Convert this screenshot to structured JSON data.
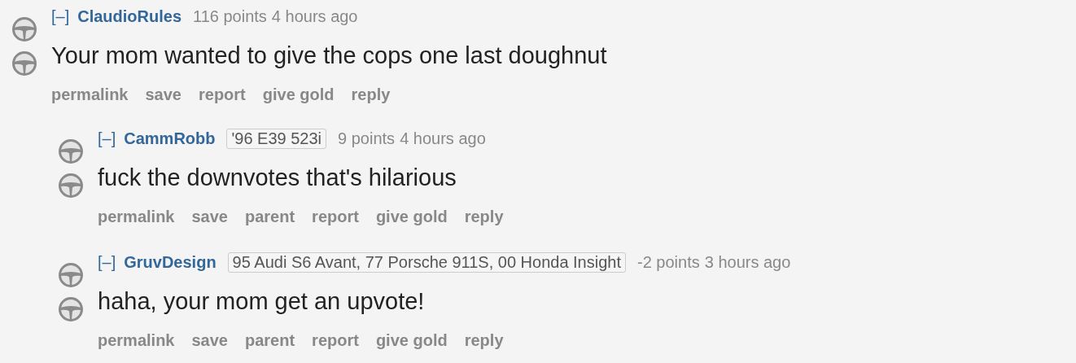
{
  "comments": [
    {
      "toggle": "[–]",
      "author": "ClaudioRules",
      "score": "116 points",
      "time": "4 hours ago",
      "body": "Your mom wanted to give the cops one last doughnut",
      "actions": [
        "permalink",
        "save",
        "report",
        "give gold",
        "reply"
      ],
      "children": [
        {
          "toggle": "[–]",
          "author": "CammRobb",
          "flair": "'96 E39 523i",
          "score": "9 points",
          "time": "4 hours ago",
          "body": "fuck the downvotes that's hilarious",
          "actions": [
            "permalink",
            "save",
            "parent",
            "report",
            "give gold",
            "reply"
          ]
        },
        {
          "toggle": "[–]",
          "author": "GruvDesign",
          "flair": "95 Audi S6 Avant, 77 Porsche 911S, 00 Honda Insight",
          "score": "-2 points",
          "time": "3 hours ago",
          "body": "haha, your mom get an upvote!",
          "actions": [
            "permalink",
            "save",
            "parent",
            "report",
            "give gold",
            "reply"
          ]
        }
      ]
    }
  ]
}
